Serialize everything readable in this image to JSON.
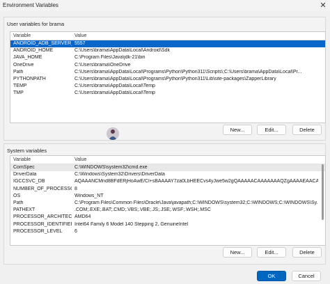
{
  "window": {
    "title": "Environment Variables",
    "close_glyph": "✕"
  },
  "user_vars": {
    "label": "User variables for brama",
    "col_variable": "Variable",
    "col_value": "Value",
    "rows": [
      {
        "name": "ANDROID_ADB_SERVER_P...",
        "value": "5557"
      },
      {
        "name": "ANDROID_HOME",
        "value": "C:\\Users\\brama\\AppData\\Local\\Android\\Sdk"
      },
      {
        "name": "JAVA_HOME",
        "value": "C:\\Program Files\\Java\\jdk-21\\bin"
      },
      {
        "name": "OneDrive",
        "value": "C:\\Users\\brama\\OneDrive"
      },
      {
        "name": "Path",
        "value": "C:\\Users\\brama\\AppData\\Local\\Programs\\Python\\Python311\\Scripts\\;C:\\Users\\brama\\AppData\\Local\\Pr..."
      },
      {
        "name": "PYTHONPATH",
        "value": "C:\\Users\\brama\\AppData\\Local\\Programs\\Python\\Python311\\Lib\\site-packages\\ZapperLibrary"
      },
      {
        "name": "TEMP",
        "value": "C:\\Users\\brama\\AppData\\Local\\Temp"
      },
      {
        "name": "TMP",
        "value": "C:\\Users\\brama\\AppData\\Local\\Temp"
      }
    ],
    "new_label": "New...",
    "edit_label": "Edit...",
    "delete_label": "Delete"
  },
  "system_vars": {
    "label": "System variables",
    "col_variable": "Variable",
    "col_value": "Value",
    "rows": [
      {
        "name": "ComSpec",
        "value": "C:\\WINDOWS\\system32\\cmd.exe"
      },
      {
        "name": "DriverData",
        "value": "C:\\Windows\\System32\\Drivers\\DriverData"
      },
      {
        "name": "IGCCSVC_DB",
        "value": "AQAAANCMnd8BFdERjHoAwE/Cl+sBAAAAY7za0LbHEECvs4yJwe5w2gQAAAAACAAAAAAAQZgAAAAEAACAAAA..."
      },
      {
        "name": "NUMBER_OF_PROCESSORS",
        "value": "8"
      },
      {
        "name": "OS",
        "value": "Windows_NT"
      },
      {
        "name": "Path",
        "value": "C:\\Program Files\\Common Files\\Oracle\\Java\\javapath;C:\\WINDOWS\\system32;C:\\WINDOWS;C:\\WINDOWS\\Sy..."
      },
      {
        "name": "PATHEXT",
        "value": ".COM;.EXE;.BAT;.CMD;.VBS;.VBE;.JS;.JSE;.WSF;.WSH;.MSC"
      },
      {
        "name": "PROCESSOR_ARCHITECTU...",
        "value": "AMD64"
      },
      {
        "name": "PROCESSOR_IDENTIFIER",
        "value": "Intel64 Family 6 Model 140 Stepping 2, GenuineIntel"
      },
      {
        "name": "PROCESSOR_LEVEL",
        "value": "6"
      }
    ],
    "new_label": "New...",
    "edit_label": "Edit...",
    "delete_label": "Delete"
  },
  "footer": {
    "ok_label": "OK",
    "cancel_label": "Cancel"
  }
}
